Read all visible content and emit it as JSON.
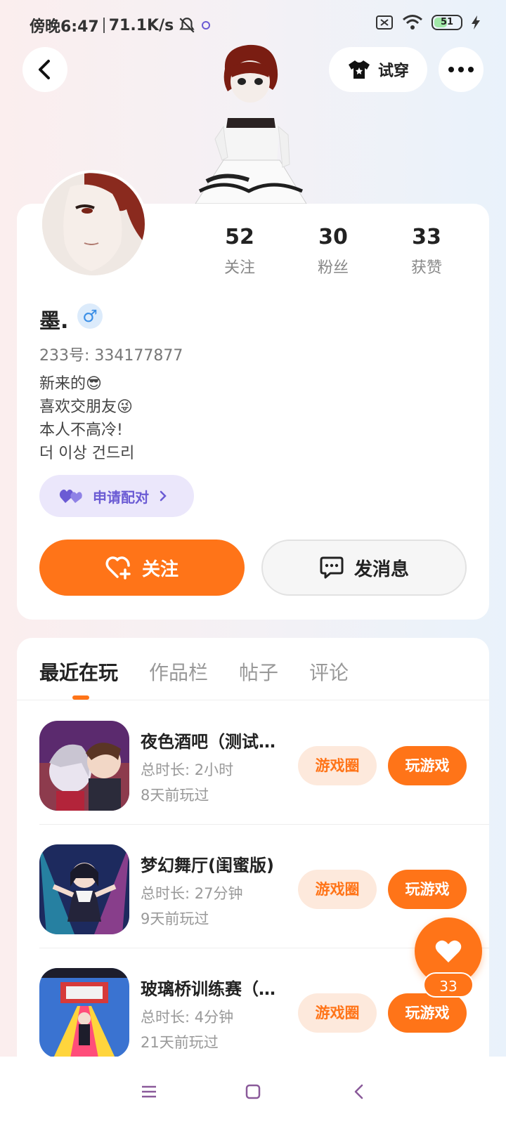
{
  "status_bar": {
    "time": "傍晚6:47",
    "network_speed": "71.1K/s",
    "battery": "51",
    "battery_level": 0.51
  },
  "header": {
    "back_icon": "chevron-left-icon",
    "tryon_label": "试穿",
    "more_icon": "more-dots-icon"
  },
  "profile": {
    "stats": [
      {
        "value": "52",
        "label": "关注"
      },
      {
        "value": "30",
        "label": "粉丝"
      },
      {
        "value": "33",
        "label": "获赞"
      }
    ],
    "nickname": "墨.",
    "gender_symbol": "♂",
    "uid": "233号: 334177877",
    "bio": [
      "新来的😎",
      "喜欢交朋友😜",
      "本人不高冷!",
      "더 이상 건드리"
    ],
    "pair_label": "申请配对",
    "follow_label": "关注",
    "message_label": "发消息"
  },
  "tabs": [
    {
      "label": "最近在玩",
      "active": true
    },
    {
      "label": "作品栏",
      "active": false
    },
    {
      "label": "帖子",
      "active": false
    },
    {
      "label": "评论",
      "active": false
    }
  ],
  "games": [
    {
      "title": "夜色酒吧（测试版）",
      "duration": "总时长: 2小时",
      "last_played": "8天前玩过",
      "circle_label": "游戏圈",
      "play_label": "玩游戏"
    },
    {
      "title": "梦幻舞厅(闺蜜版)",
      "duration": "总时长: 27分钟",
      "last_played": "9天前玩过",
      "circle_label": "游戏圈",
      "play_label": "玩游戏"
    },
    {
      "title": "玻璃桥训练赛（正式版）",
      "duration": "总时长: 4分钟",
      "last_played": "21天前玩过",
      "circle_label": "游戏圈",
      "play_label": "玩游戏"
    }
  ],
  "like_fab": {
    "count": "33"
  },
  "colors": {
    "accent": "#ff7418",
    "pair": "#6b5bd4",
    "gender": "#3a8ee6"
  }
}
